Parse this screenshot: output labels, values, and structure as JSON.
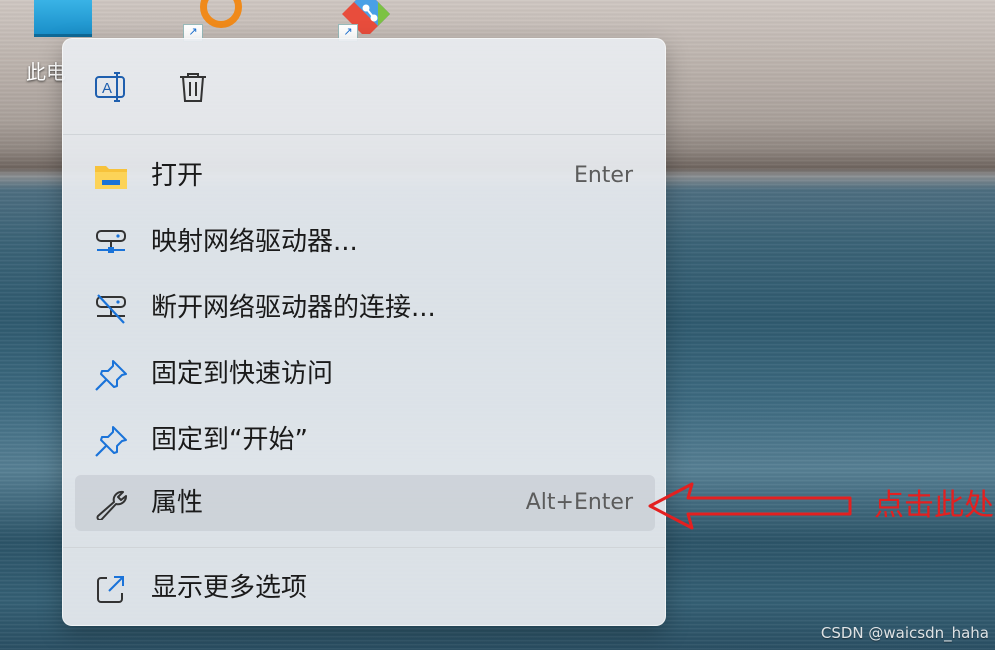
{
  "desktop": {
    "pc_icon_label": "此电",
    "shortcut_badge": "↗"
  },
  "menu": {
    "top_actions": [
      {
        "name": "rename",
        "icon": "rename-icon"
      },
      {
        "name": "delete",
        "icon": "trash-icon"
      }
    ],
    "items": [
      {
        "label": "打开",
        "shortcut": "Enter",
        "icon": "folder-icon"
      },
      {
        "label": "映射网络驱动器...",
        "shortcut": "",
        "icon": "network-drive-icon"
      },
      {
        "label": "断开网络驱动器的连接...",
        "shortcut": "",
        "icon": "disconnect-network-drive-icon"
      },
      {
        "label": "固定到快速访问",
        "shortcut": "",
        "icon": "pin-icon"
      },
      {
        "label": "固定到“开始”",
        "shortcut": "",
        "icon": "pin-icon"
      },
      {
        "label": "属性",
        "shortcut": "Alt+Enter",
        "icon": "wrench-icon"
      },
      {
        "label": "显示更多选项",
        "shortcut": "",
        "icon": "open-external-icon"
      }
    ],
    "colors": {
      "accent": "#1a73d9",
      "folder_yellow": "#f7c23a"
    }
  },
  "annotation": {
    "text": "点击此处",
    "color": "#e32020"
  },
  "watermark": "CSDN @waicsdn_haha"
}
